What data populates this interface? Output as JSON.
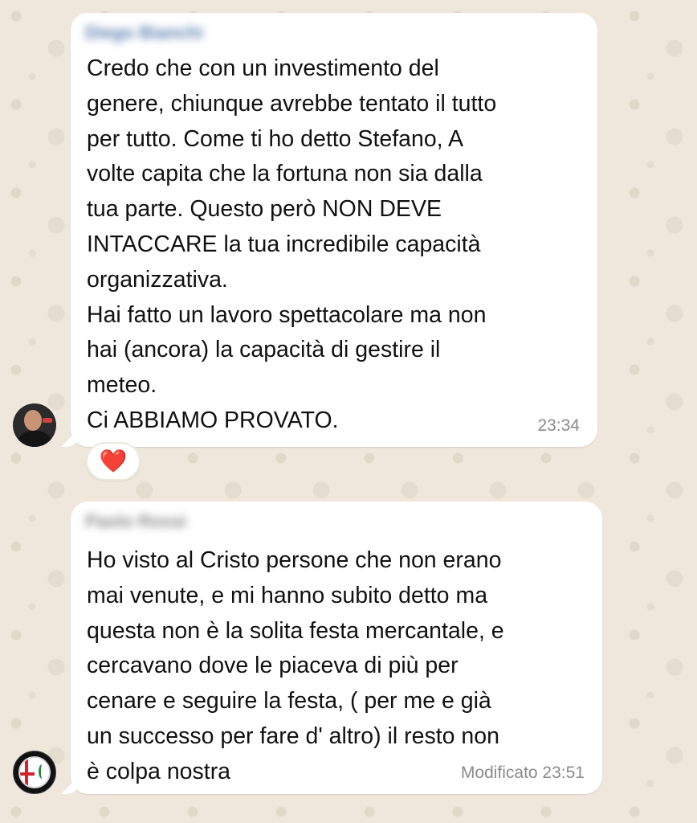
{
  "messages": [
    {
      "sender": "Diego Bianchi",
      "text": "Credo che con un investimento del\ngenere, chiunque avrebbe tentato il tutto\nper tutto. Come ti ho detto Stefano,   A\nvolte capita che la fortuna non sia dalla\ntua parte. Questo però NON DEVE\nINTACCARE la tua incredibile capacità\norganizzativa.\nHai fatto un lavoro spettacolare ma non\nhai (ancora) la capacità di gestire il\nmeteo.\nCi ABBIAMO PROVATO.",
      "time": "23:34",
      "reaction": "❤️"
    },
    {
      "sender": "Paolo Rossi",
      "text": "Ho visto al Cristo persone che non erano\nmai venute, e mi hanno subito detto ma\nquesta non è la solita festa mercantale,  e\ncercavano dove le piaceva di più per\ncenare e seguire la festa, ( per me e già\nun successo per fare d' altro) il resto non\nè colpa nostra",
      "time": "Modificato 23:51"
    }
  ],
  "colors": {
    "background": "#efe7dc",
    "bubble": "#ffffff",
    "timestamp": "#8b8b8b"
  }
}
